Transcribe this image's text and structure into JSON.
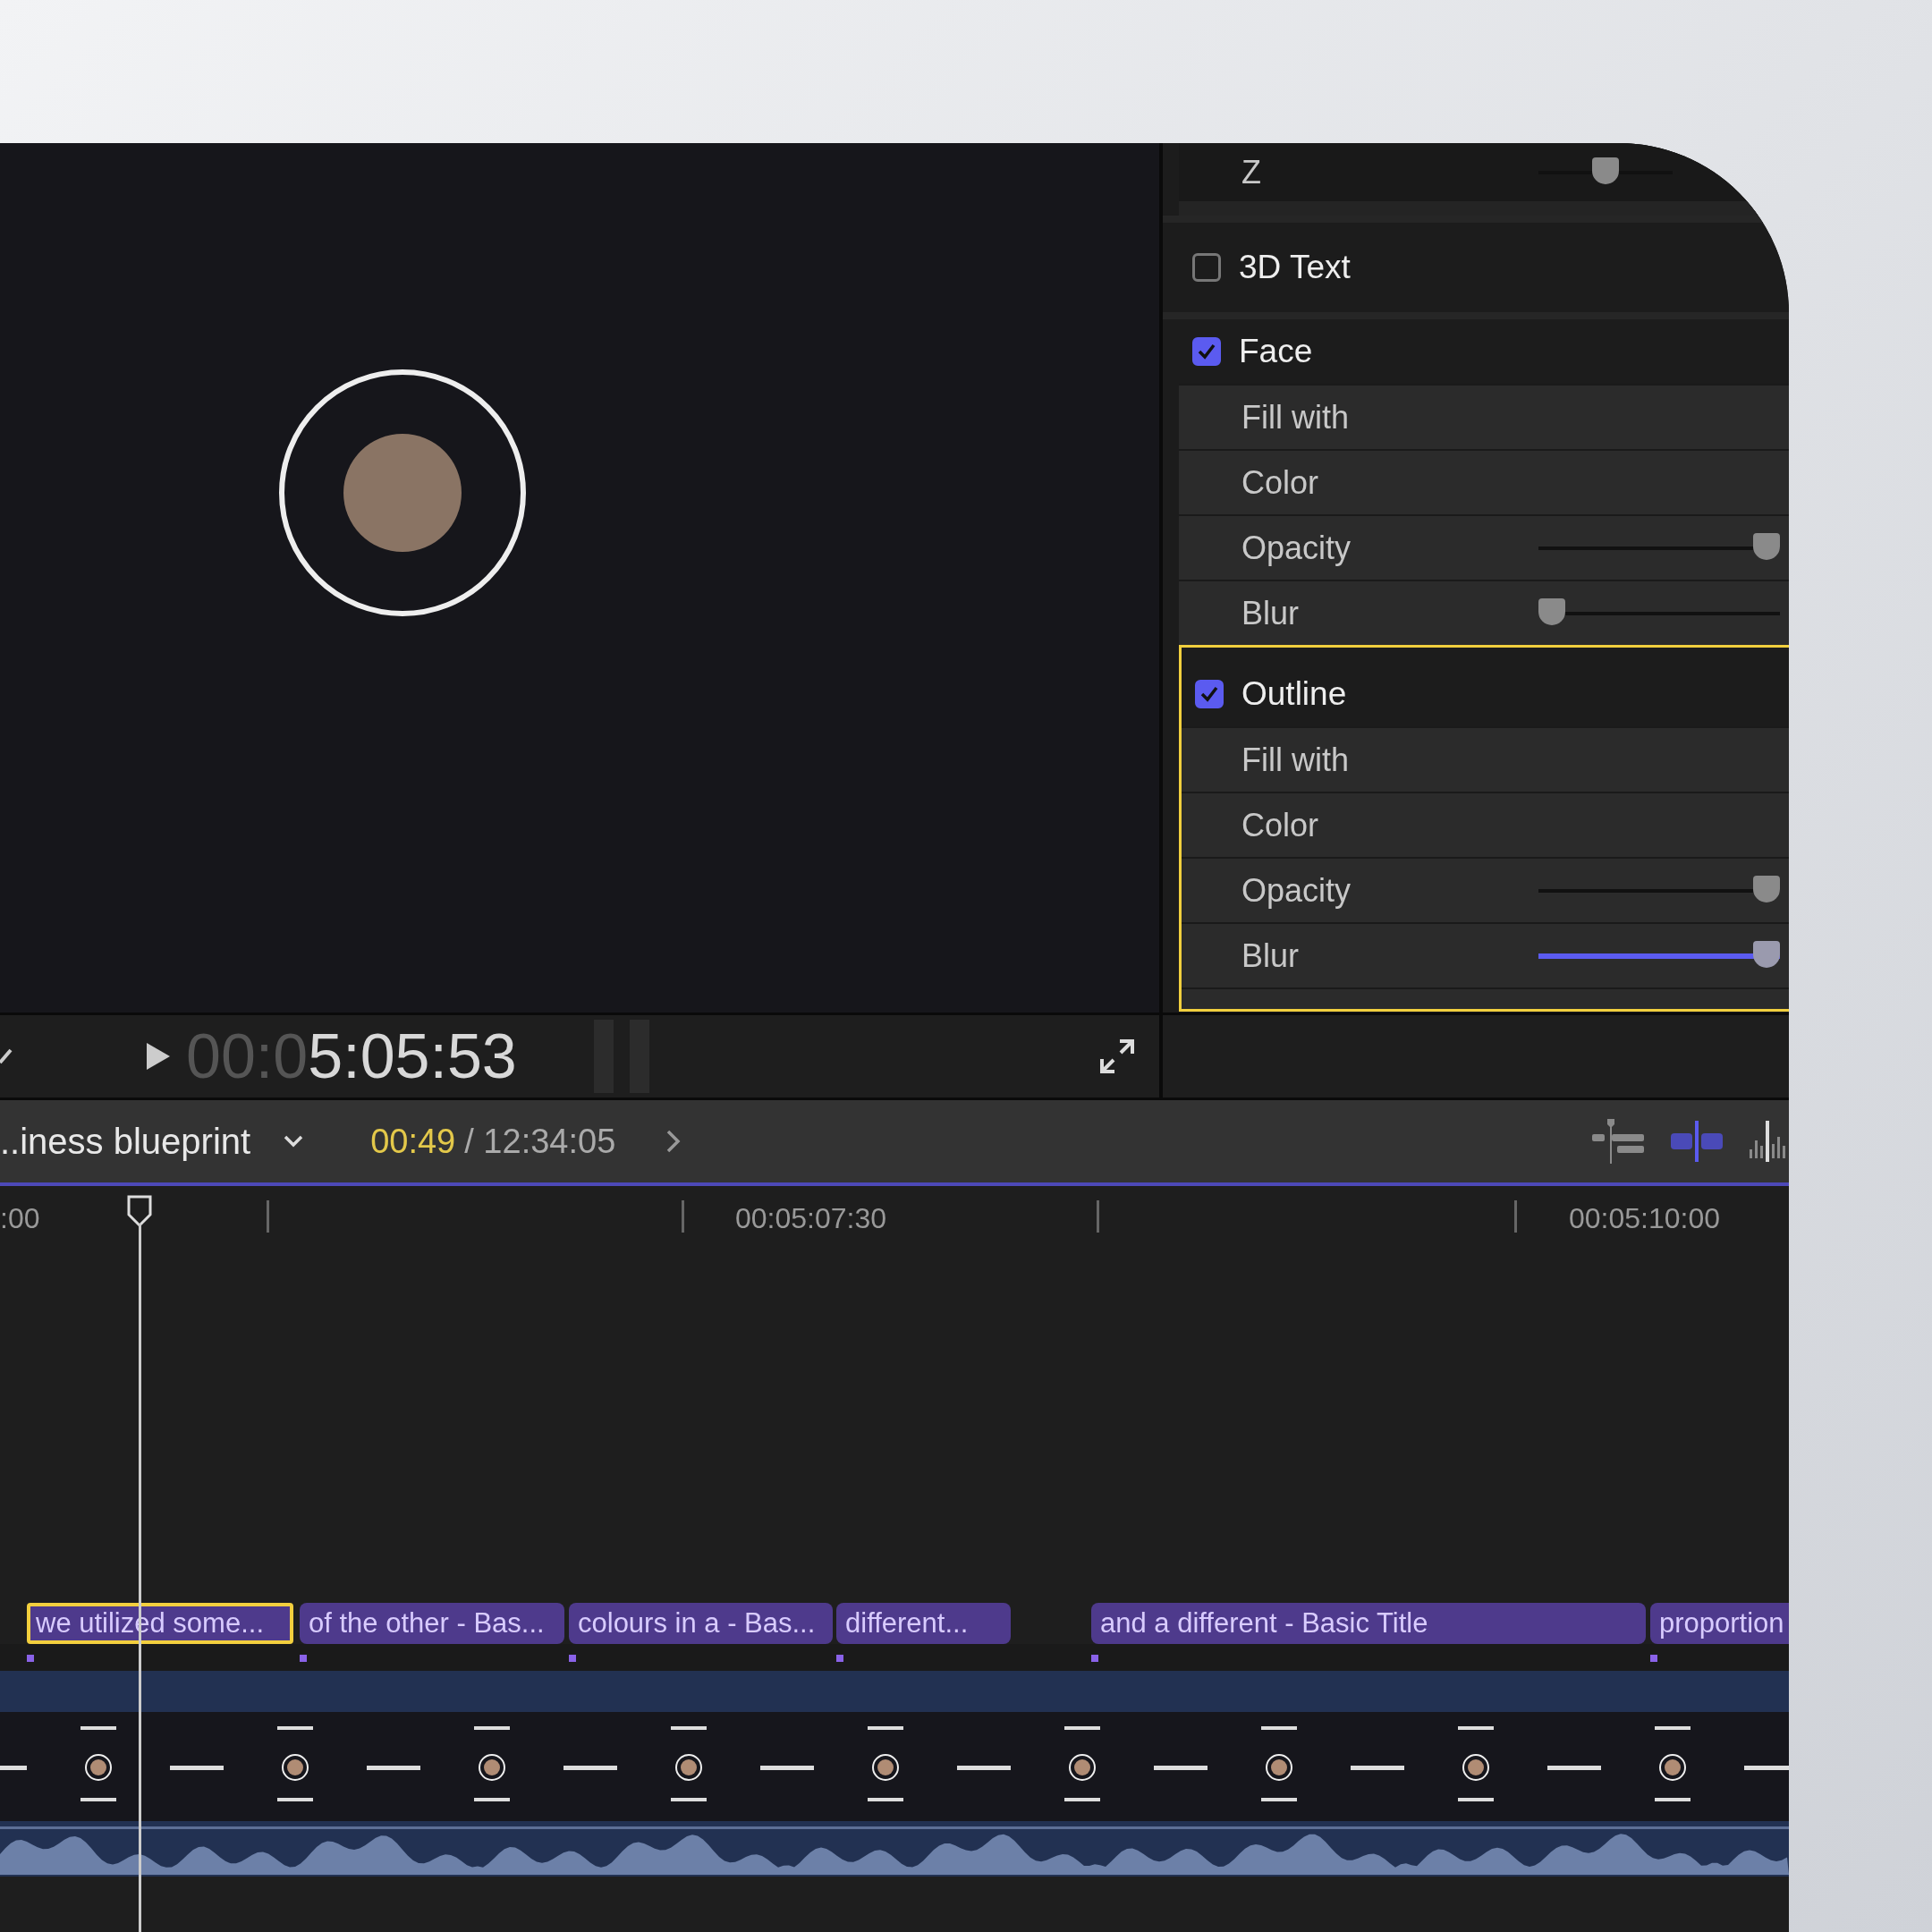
{
  "inspector": {
    "z_row": {
      "label": "Z",
      "level": 0.5
    },
    "sections": [
      {
        "title": "3D Text",
        "checked": false,
        "selected": false
      },
      {
        "title": "Face",
        "checked": true,
        "selected": false,
        "rows": [
          {
            "label": "Fill with",
            "kind": "plain"
          },
          {
            "label": "Color",
            "kind": "plain"
          },
          {
            "label": "Opacity",
            "kind": "slider",
            "level": 1,
            "accent": false
          },
          {
            "label": "Blur",
            "kind": "slider",
            "level": 0,
            "accent": false
          }
        ]
      },
      {
        "title": "Outline",
        "checked": true,
        "selected": true,
        "rows": [
          {
            "label": "Fill with",
            "kind": "plain"
          },
          {
            "label": "Color",
            "kind": "plain"
          },
          {
            "label": "Opacity",
            "kind": "slider",
            "level": 1,
            "accent": false
          },
          {
            "label": "Blur",
            "kind": "slider",
            "level": 1,
            "accent": true
          }
        ]
      }
    ]
  },
  "transport": {
    "timecode": {
      "leading": "00:0",
      "value": "5:05:53"
    }
  },
  "timeline": {
    "project_name": "..iness blueprint",
    "playhead_time": "00:49",
    "duration": "/ 12:34:05",
    "toggles": [
      {
        "kind": "position",
        "on": false
      },
      {
        "kind": "clips",
        "on": true
      },
      {
        "kind": "audio",
        "on": false
      }
    ],
    "ruler_labels": [
      ":00",
      "00:05:07:30",
      "00:05:10:00"
    ],
    "clips": [
      {
        "label": "we utilized some...",
        "selected": true
      },
      {
        "label": "of the other - Bas...",
        "selected": false
      },
      {
        "label": "colours in a - Bas...",
        "selected": false
      },
      {
        "label": "different...",
        "selected": false
      },
      {
        "label": "and a different - Basic Title",
        "selected": false
      },
      {
        "label": "proportion",
        "selected": false
      }
    ]
  }
}
